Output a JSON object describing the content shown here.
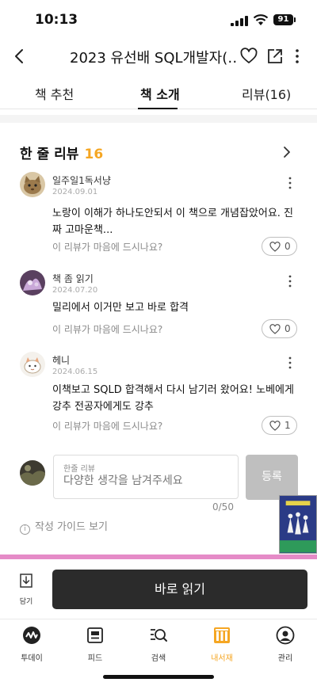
{
  "status": {
    "time": "10:13",
    "battery": "91"
  },
  "header": {
    "title": "2023 유선배 SQL개발자(…"
  },
  "tabs": [
    {
      "label": "책 추천"
    },
    {
      "label": "책 소개"
    },
    {
      "label": "리뷰(16)"
    }
  ],
  "review_section": {
    "title": "한 줄 리뷰",
    "count": "16"
  },
  "reviews": [
    {
      "name": "일주일1독서냥",
      "date": "2024.09.01",
      "text": "노랑이 이해가 하나도안되서 이 책으로 개념잡았어요. 진짜 고마운책...",
      "ask": "이 리뷰가 마음에 드시나요?",
      "likes": "0"
    },
    {
      "name": "책 좀 읽기",
      "date": "2024.07.20",
      "text": "밀리에서 이거만 보고 바로 합격",
      "ask": "이 리뷰가 마음에 드시나요?",
      "likes": "0"
    },
    {
      "name": "헤니",
      "date": "2024.06.15",
      "text": "이책보고 SQLD 합격해서 다시 남기러 왔어요! 노베에게 강추 전공자에게도 강추",
      "ask": "이 리뷰가 마음에 드시나요?",
      "likes": "1"
    }
  ],
  "write": {
    "label": "한줄 리뷰",
    "placeholder": "다양한 생각을 남겨주세요",
    "submit": "등록",
    "char_count": "0/50"
  },
  "guide": {
    "label": "작성 가이드 보기"
  },
  "action_bar": {
    "save_label": "담기",
    "read_label": "바로 읽기"
  },
  "nav": [
    {
      "label": "투데이",
      "icon": "today-icon"
    },
    {
      "label": "피드",
      "icon": "feed-icon"
    },
    {
      "label": "검색",
      "icon": "search-icon"
    },
    {
      "label": "내서재",
      "icon": "library-icon"
    },
    {
      "label": "관리",
      "icon": "profile-icon"
    }
  ],
  "colors": {
    "accent": "#f5a623",
    "pink_bar": "#e58bc7",
    "read_button": "#2b2b2b"
  }
}
